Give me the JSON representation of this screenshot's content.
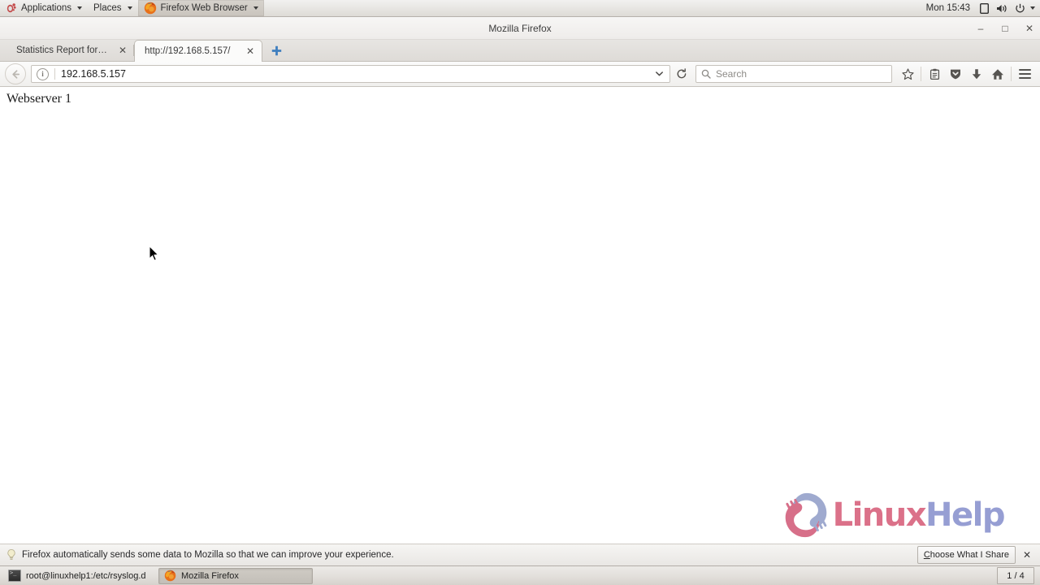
{
  "desktop": {
    "panel": {
      "applications_label": "Applications",
      "places_label": "Places",
      "active_app_label": "Firefox Web Browser",
      "clock": "Mon 15:43"
    },
    "taskbar": {
      "tasks": [
        {
          "label": "root@linuxhelp1:/etc/rsyslog.d",
          "icon": "terminal-icon",
          "active": false
        },
        {
          "label": "Mozilla Firefox",
          "icon": "firefox-icon",
          "active": true
        }
      ],
      "workspace_indicator": "1 / 4"
    }
  },
  "window": {
    "title": "Mozilla Firefox",
    "buttons": {
      "minimize": "–",
      "maximize": "□",
      "close": "✕"
    }
  },
  "browser": {
    "tabs": [
      {
        "label": "Statistics Report for HA...",
        "active": false,
        "close": "✕"
      },
      {
        "label": "http://192.168.5.157/",
        "active": true,
        "close": "✕"
      }
    ],
    "new_tab_tooltip": "+",
    "toolbar": {
      "url_value": "192.168.5.157",
      "search_placeholder": "Search",
      "icons": [
        "bookmark-star-icon",
        "reading-list-icon",
        "pocket-shield-icon",
        "downloads-icon",
        "home-icon",
        "menu-hamburger-icon"
      ]
    },
    "notification": {
      "message": "Firefox automatically sends some data to Mozilla so that we can improve your experience.",
      "button_accesskey": "C",
      "button_rest": "hoose What I Share",
      "close": "✕"
    }
  },
  "page": {
    "body_text": "Webserver 1",
    "watermark": {
      "part1": "Linux",
      "part2": "Help"
    }
  },
  "colors": {
    "watermark_pink": "#d9657f",
    "watermark_blue": "#8e96d0",
    "newtab_blue": "#3f7fbf",
    "panel_bg": "#e8e6e3"
  }
}
